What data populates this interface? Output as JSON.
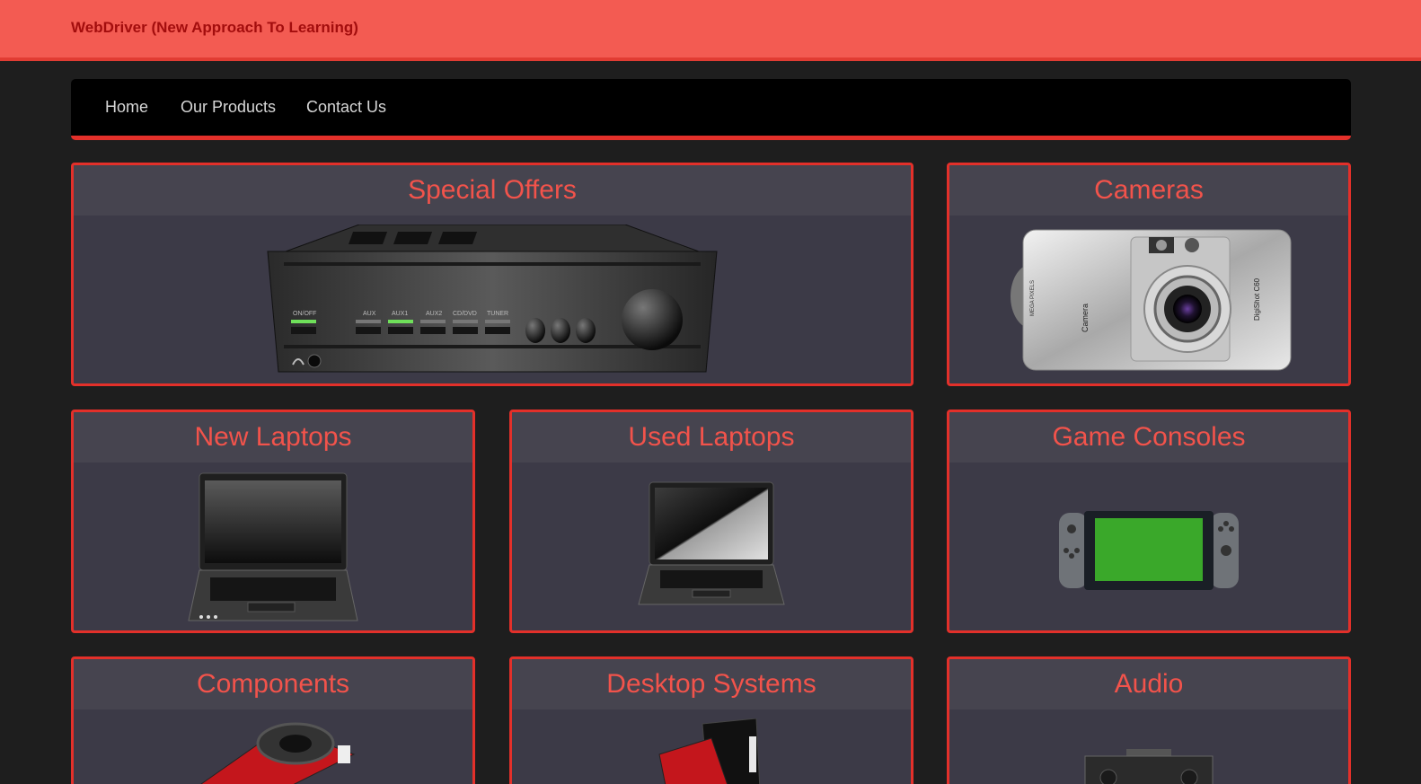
{
  "header": {
    "brand": "WebDriver (New Approach To Learning)"
  },
  "nav": {
    "items": [
      "Home",
      "Our Products",
      "Contact Us"
    ]
  },
  "tiles": [
    {
      "title": "Special Offers",
      "image": "amplifier-image"
    },
    {
      "title": "Cameras",
      "image": "camera-image"
    },
    {
      "title": "New Laptops",
      "image": "laptop-image"
    },
    {
      "title": "Used Laptops",
      "image": "laptop-image"
    },
    {
      "title": "Game Consoles",
      "image": "game-console-image"
    },
    {
      "title": "Components",
      "image": "graphics-card-image"
    },
    {
      "title": "Desktop Systems",
      "image": "desktop-pc-image"
    },
    {
      "title": "Audio",
      "image": "stereo-image"
    }
  ],
  "amplifier": {
    "labels": [
      "ON/OFF",
      "AUX",
      "AUX1",
      "AUX2",
      "CD/DVD",
      "TUNER"
    ]
  },
  "camera": {
    "brand": "Camera",
    "model": "DigiShot C60",
    "mega": "MEGA PIXELS"
  },
  "colors": {
    "accent": "#e3302a",
    "title": "#f2534b",
    "banner": "#f35b52"
  }
}
